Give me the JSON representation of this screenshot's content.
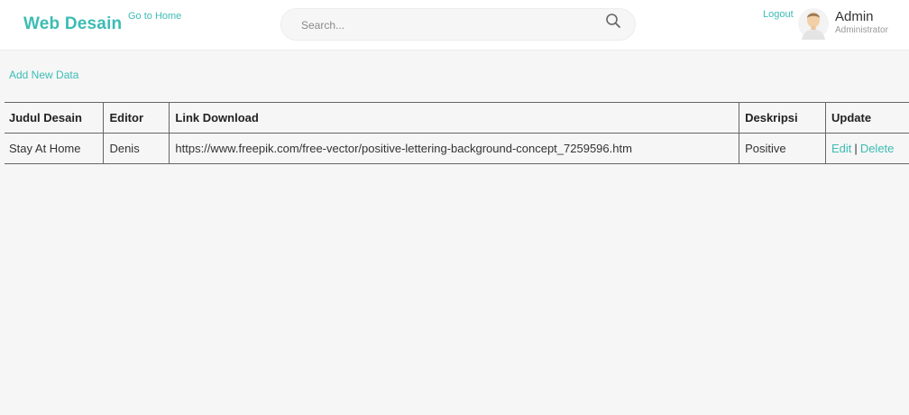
{
  "header": {
    "brand": "Web Desain",
    "goto_home": "Go to Home",
    "search_placeholder": "Search...",
    "logout": "Logout",
    "user_name": "Admin",
    "user_role": "Administrator"
  },
  "actions": {
    "add_new": "Add New Data"
  },
  "table": {
    "headers": [
      "Judul Desain",
      "Editor",
      "Link Download",
      "Deskripsi",
      "Update"
    ],
    "rows": [
      {
        "judul": "Stay At Home",
        "editor": "Denis",
        "link": "https://www.freepik.com/free-vector/positive-lettering-background-concept_7259596.htm",
        "deskripsi": "Positive",
        "edit": "Edit",
        "separator": "|",
        "delete": "Delete"
      }
    ]
  },
  "colors": {
    "accent": "#3cbcb4",
    "background": "#f6f6f6"
  },
  "icons": {
    "search": "search-icon",
    "avatar": "user-avatar"
  }
}
